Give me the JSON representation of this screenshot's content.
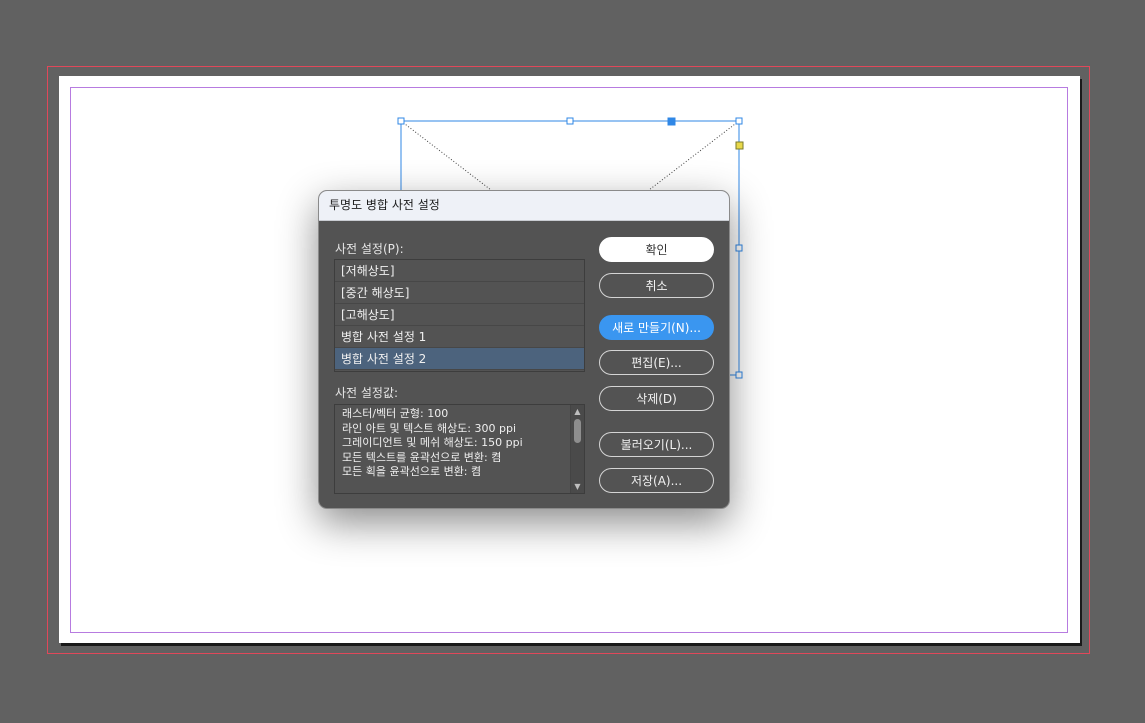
{
  "dialog": {
    "title": "투명도 병합 사전 설정",
    "presets_label": "사전 설정(P):",
    "presets": [
      {
        "label": "[저해상도]",
        "selected": false
      },
      {
        "label": "[중간 해상도]",
        "selected": false
      },
      {
        "label": "[고해상도]",
        "selected": false
      },
      {
        "label": "병합 사전 설정 1",
        "selected": false
      },
      {
        "label": "병합 사전 설정 2",
        "selected": true
      }
    ],
    "settings_label": "사전 설정값:",
    "settings_lines": [
      "래스터/벡터 균형: 100",
      "라인 아트 및 텍스트 해상도: 300 ppi",
      "그레이디언트 및 메쉬 해상도: 150 ppi",
      "모든 텍스트를 윤곽선으로 변환: 켬",
      "모든 획을 윤곽선으로 변환: 켬"
    ],
    "buttons": {
      "ok": "확인",
      "cancel": "취소",
      "new": "새로 만들기(N)...",
      "edit": "편집(E)...",
      "delete": "삭제(D)",
      "load": "불러오기(L)...",
      "save": "저장(A)..."
    }
  },
  "colors": {
    "pasteboard": "#616161",
    "bleed_guide": "#e0485a",
    "margin_guide": "#b77be0",
    "frame_selection": "#2f87e6",
    "accent_button": "#3a96f0",
    "selected_row": "#4c637d"
  }
}
